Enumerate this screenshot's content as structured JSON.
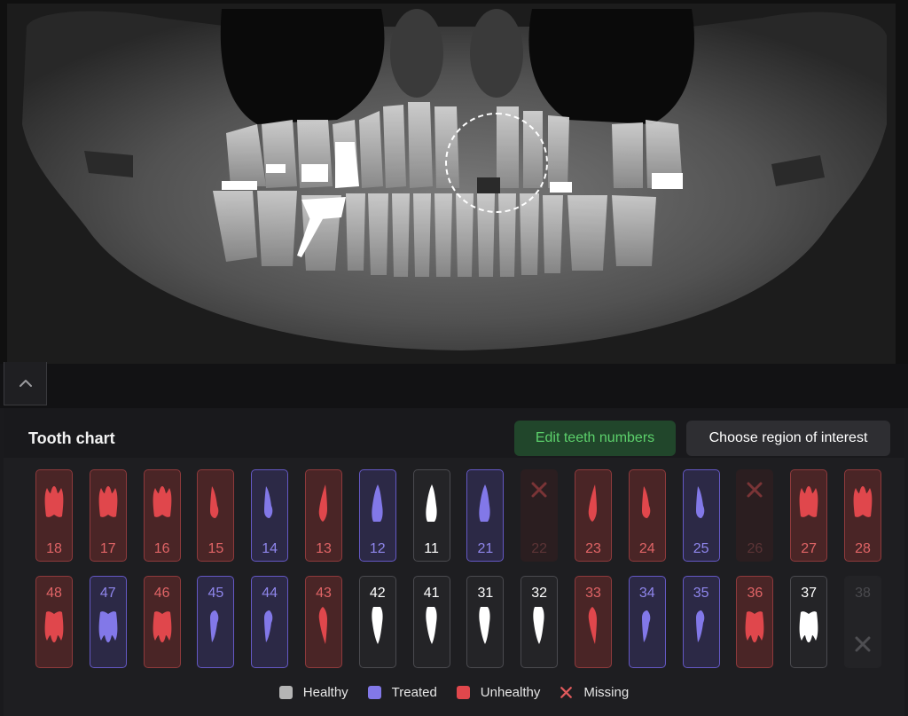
{
  "panel": {
    "title": "Tooth chart",
    "edit_label": "Edit teeth numbers",
    "roi_label": "Choose region of interest"
  },
  "colors": {
    "healthy": "#b5b5b5",
    "treated": "#8278e8",
    "unhealthy": "#e0474c",
    "missing": "#e05a5c"
  },
  "upper_teeth": [
    {
      "number": "18",
      "status": "unhealthy",
      "shape": "molar"
    },
    {
      "number": "17",
      "status": "unhealthy",
      "shape": "molar"
    },
    {
      "number": "16",
      "status": "unhealthy",
      "shape": "molar"
    },
    {
      "number": "15",
      "status": "unhealthy",
      "shape": "premolar"
    },
    {
      "number": "14",
      "status": "treated",
      "shape": "premolar"
    },
    {
      "number": "13",
      "status": "unhealthy",
      "shape": "canine"
    },
    {
      "number": "12",
      "status": "treated",
      "shape": "incisor"
    },
    {
      "number": "11",
      "status": "healthy",
      "shape": "incisor"
    },
    {
      "number": "21",
      "status": "treated",
      "shape": "incisor"
    },
    {
      "number": "22",
      "status": "missing",
      "shape": "missing"
    },
    {
      "number": "23",
      "status": "unhealthy",
      "shape": "canine"
    },
    {
      "number": "24",
      "status": "unhealthy",
      "shape": "premolar"
    },
    {
      "number": "25",
      "status": "treated",
      "shape": "premolar"
    },
    {
      "number": "26",
      "status": "missing",
      "shape": "missing"
    },
    {
      "number": "27",
      "status": "unhealthy",
      "shape": "molar"
    },
    {
      "number": "28",
      "status": "unhealthy",
      "shape": "molar"
    }
  ],
  "lower_teeth": [
    {
      "number": "48",
      "status": "unhealthy",
      "shape": "molar"
    },
    {
      "number": "47",
      "status": "treated",
      "shape": "molar"
    },
    {
      "number": "46",
      "status": "unhealthy",
      "shape": "molar"
    },
    {
      "number": "45",
      "status": "treated",
      "shape": "premolar"
    },
    {
      "number": "44",
      "status": "treated",
      "shape": "premolar"
    },
    {
      "number": "43",
      "status": "unhealthy",
      "shape": "canine"
    },
    {
      "number": "42",
      "status": "healthy",
      "shape": "incisor"
    },
    {
      "number": "41",
      "status": "healthy",
      "shape": "incisor"
    },
    {
      "number": "31",
      "status": "healthy",
      "shape": "incisor"
    },
    {
      "number": "32",
      "status": "healthy",
      "shape": "incisor"
    },
    {
      "number": "33",
      "status": "unhealthy",
      "shape": "canine"
    },
    {
      "number": "34",
      "status": "treated",
      "shape": "premolar"
    },
    {
      "number": "35",
      "status": "treated",
      "shape": "premolar"
    },
    {
      "number": "36",
      "status": "unhealthy",
      "shape": "molar"
    },
    {
      "number": "37",
      "status": "healthy",
      "shape": "molar"
    },
    {
      "number": "38",
      "status": "missing",
      "shape": "missing"
    }
  ],
  "legend": [
    {
      "label": "Healthy",
      "color": "#b5b5b5",
      "kind": "square"
    },
    {
      "label": "Treated",
      "color": "#8278e8",
      "kind": "square"
    },
    {
      "label": "Unhealthy",
      "color": "#e0474c",
      "kind": "square"
    },
    {
      "label": "Missing",
      "color": "#e05a5c",
      "kind": "cross"
    }
  ]
}
